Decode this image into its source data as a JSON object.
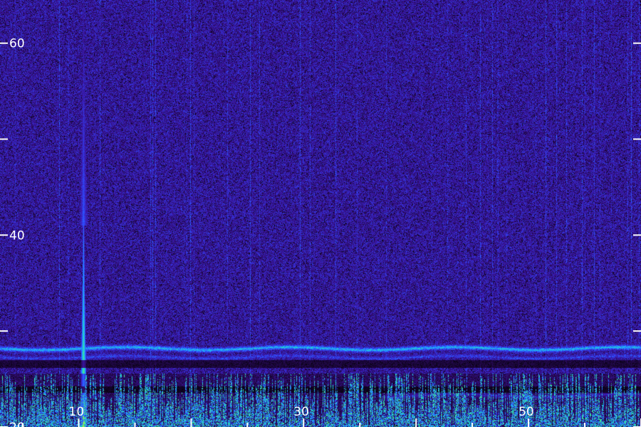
{
  "chart_data": {
    "type": "heatmap",
    "title": "",
    "xlabel": "",
    "ylabel": "",
    "xlim": [
      3,
      60
    ],
    "ylim": [
      20,
      64.5
    ],
    "grid": false,
    "legend": "none",
    "x_tick_values": [
      10,
      20,
      30,
      40,
      50,
      60
    ],
    "x_tick_labels": [
      "10",
      "",
      "30",
      "",
      "50",
      ""
    ],
    "x_minor_tick_values": [
      5,
      15,
      25,
      35,
      45,
      55
    ],
    "y_tick_values": [
      20,
      30,
      40,
      50,
      60
    ],
    "y_tick_labels": [
      "20",
      "",
      "40",
      "",
      "60"
    ],
    "colormap": [
      "#000000",
      "#2a0a5c",
      "#3a17a8",
      "#2f4bff",
      "#1fa7ff",
      "#27e3b2",
      "#8cf542",
      "#f2ff2a"
    ],
    "background_level": 0.28,
    "features": [
      {
        "kind": "vertical_line",
        "x": 10.4,
        "intensity": 0.9,
        "y_from": 20,
        "y_to": 41
      },
      {
        "kind": "vertical_line",
        "x": 10.4,
        "intensity": 0.45,
        "y_from": 41,
        "y_to": 64.5
      },
      {
        "kind": "horizontal_band",
        "y": 28.2,
        "intensity": 0.62,
        "x_from": 3,
        "x_to": 60
      },
      {
        "kind": "horizontal_band",
        "y": 27.3,
        "intensity": 0.4,
        "x_from": 3,
        "x_to": 60
      },
      {
        "kind": "horizontal_band",
        "y": 23.3,
        "intensity": 0.5,
        "x_from": 37,
        "x_to": 60
      },
      {
        "kind": "dark_band",
        "y_from": 26.2,
        "y_to": 27.0
      },
      {
        "kind": "dark_band",
        "y_from": 23.6,
        "y_to": 24.3
      },
      {
        "kind": "noise_region",
        "y_from": 20,
        "y_to": 25.6,
        "intensity": 0.72
      }
    ]
  }
}
